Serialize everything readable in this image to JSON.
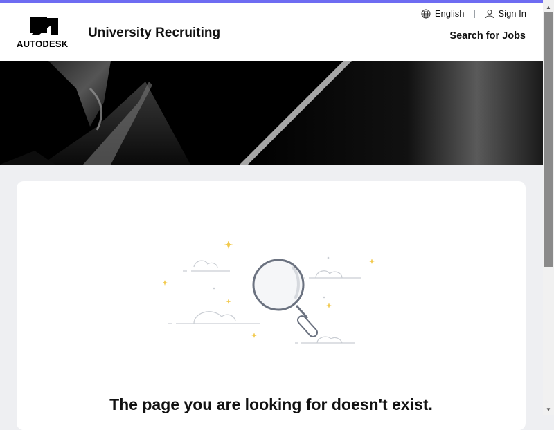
{
  "colors": {
    "accent": "#6e6cf2",
    "background": "#eeeff2",
    "hero": "#000000"
  },
  "brand": {
    "logo_text": "AUTODESK",
    "site_title": "University Recruiting"
  },
  "utility_nav": {
    "language_label": "English",
    "language_icon": "globe-icon",
    "sign_in_label": "Sign In",
    "sign_in_icon": "user-icon"
  },
  "nav": {
    "search_jobs_label": "Search for Jobs"
  },
  "error": {
    "illustration_icon": "magnifying-glass-icon",
    "message": "The page you are looking for doesn't exist."
  }
}
